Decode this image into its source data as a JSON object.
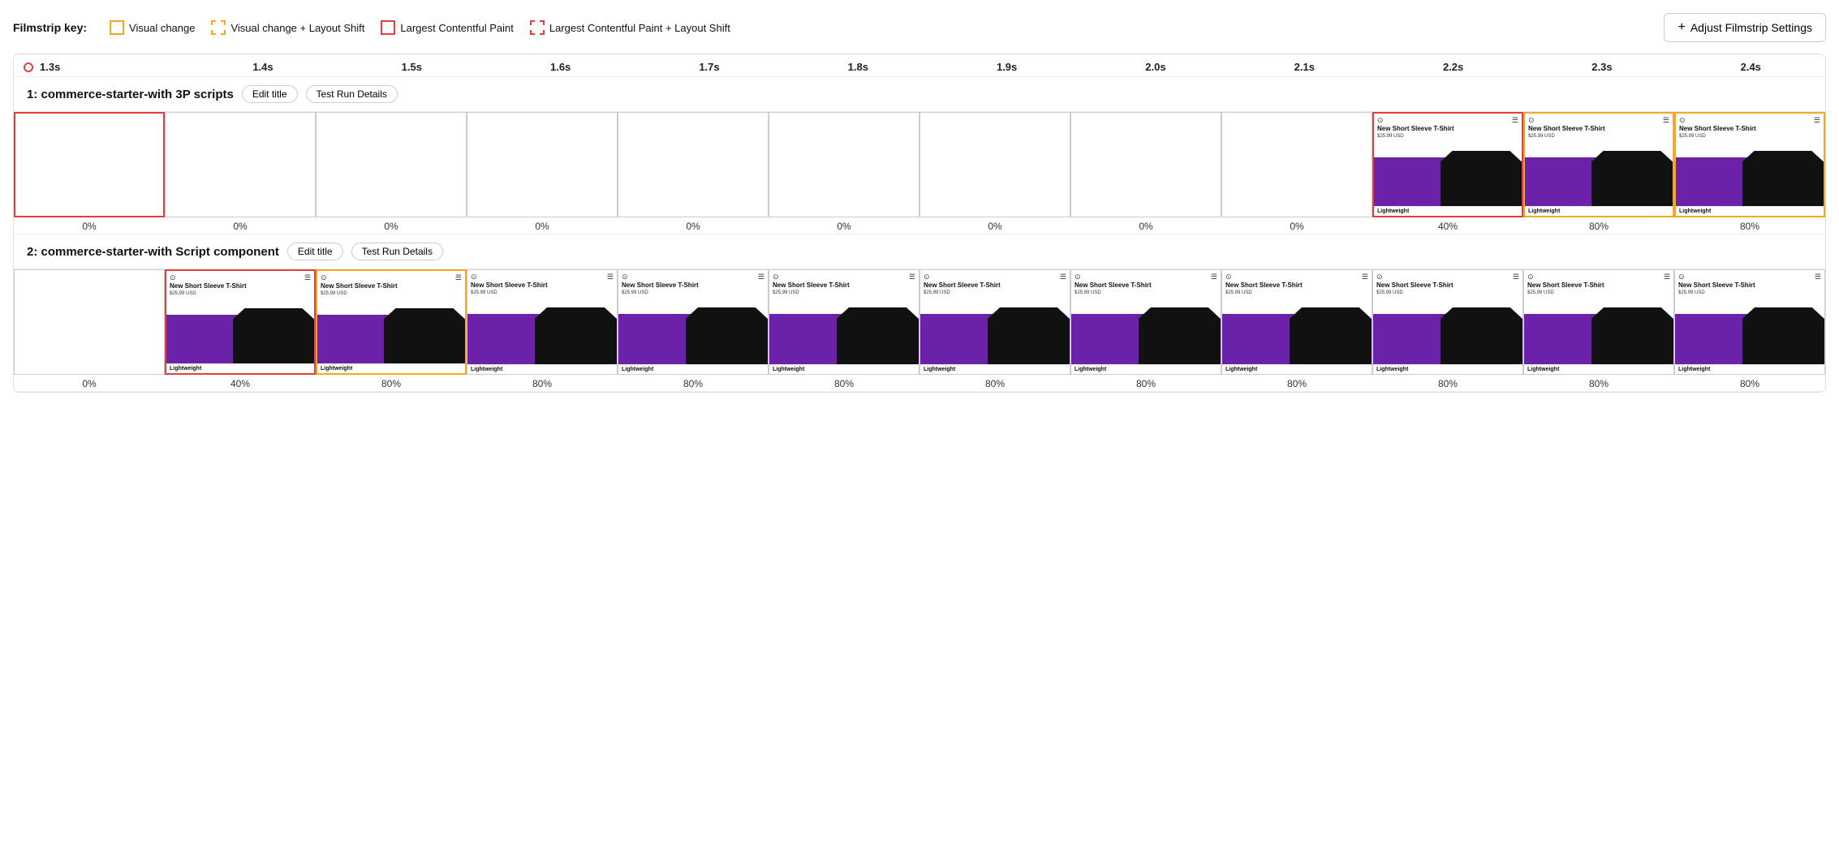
{
  "legend": {
    "label": "Filmstrip key:",
    "items": [
      {
        "id": "visual-change",
        "type": "yellow-solid",
        "text": "Visual change"
      },
      {
        "id": "visual-change-layout-shift",
        "type": "yellow-dashed",
        "text": "Visual change + Layout Shift"
      },
      {
        "id": "lcp",
        "type": "red-solid",
        "text": "Largest Contentful Paint"
      },
      {
        "id": "lcp-layout-shift",
        "type": "red-dashed",
        "text": "Largest Contentful Paint + Layout Shift"
      }
    ],
    "adjust_button": "Adjust Filmstrip Settings"
  },
  "timeline": {
    "ticks": [
      "1.3s",
      "1.4s",
      "1.5s",
      "1.6s",
      "1.7s",
      "1.8s",
      "1.9s",
      "2.0s",
      "2.1s",
      "2.2s",
      "2.3s",
      "2.4s"
    ]
  },
  "test_runs": [
    {
      "id": "run1",
      "title": "1: commerce-starter-with 3P scripts",
      "edit_title_label": "Edit title",
      "test_run_details_label": "Test Run Details",
      "frames": [
        {
          "border": "red-solid",
          "blank": true,
          "pct": "0%"
        },
        {
          "border": "none",
          "blank": true,
          "pct": "0%"
        },
        {
          "border": "none",
          "blank": true,
          "pct": "0%"
        },
        {
          "border": "none",
          "blank": true,
          "pct": "0%"
        },
        {
          "border": "none",
          "blank": true,
          "pct": "0%"
        },
        {
          "border": "none",
          "blank": true,
          "pct": "0%"
        },
        {
          "border": "none",
          "blank": true,
          "pct": "0%"
        },
        {
          "border": "none",
          "blank": true,
          "pct": "0%"
        },
        {
          "border": "none",
          "blank": true,
          "pct": "0%"
        },
        {
          "border": "red-solid",
          "blank": false,
          "pct": "40%"
        },
        {
          "border": "yellow-solid",
          "blank": false,
          "pct": "80%"
        },
        {
          "border": "yellow-solid",
          "blank": false,
          "pct": "80%"
        }
      ]
    },
    {
      "id": "run2",
      "title": "2: commerce-starter-with Script component",
      "edit_title_label": "Edit title",
      "test_run_details_label": "Test Run Details",
      "frames": [
        {
          "border": "none",
          "blank": true,
          "pct": "0%"
        },
        {
          "border": "red-solid",
          "blank": false,
          "pct": "40%"
        },
        {
          "border": "yellow-solid",
          "blank": false,
          "pct": "80%"
        },
        {
          "border": "none",
          "blank": false,
          "pct": "80%"
        },
        {
          "border": "none",
          "blank": false,
          "pct": "80%"
        },
        {
          "border": "none",
          "blank": false,
          "pct": "80%"
        },
        {
          "border": "none",
          "blank": false,
          "pct": "80%"
        },
        {
          "border": "none",
          "blank": false,
          "pct": "80%"
        },
        {
          "border": "none",
          "blank": false,
          "pct": "80%"
        },
        {
          "border": "none",
          "blank": false,
          "pct": "80%"
        },
        {
          "border": "none",
          "blank": false,
          "pct": "80%"
        },
        {
          "border": "none",
          "blank": false,
          "pct": "80%"
        }
      ]
    }
  ]
}
